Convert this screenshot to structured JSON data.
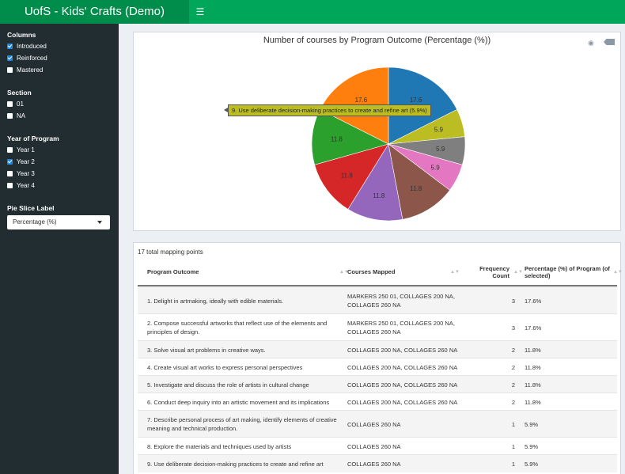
{
  "header": {
    "title": "UofS - Kids' Crafts (Demo)",
    "menu_icon": "hamburger-icon"
  },
  "sidebar": {
    "columns": {
      "title": "Columns",
      "options": [
        {
          "label": "Introduced",
          "checked": true
        },
        {
          "label": "Reinforced",
          "checked": true
        },
        {
          "label": "Mastered",
          "checked": false
        }
      ]
    },
    "section": {
      "title": "Section",
      "options": [
        {
          "label": "01",
          "checked": false
        },
        {
          "label": "NA",
          "checked": false
        }
      ]
    },
    "year": {
      "title": "Year of Program",
      "options": [
        {
          "label": "Year 1",
          "checked": false
        },
        {
          "label": "Year 2",
          "checked": true
        },
        {
          "label": "Year 3",
          "checked": false
        },
        {
          "label": "Year 4",
          "checked": false
        }
      ]
    },
    "pie_label": {
      "title": "Pie Slice Label",
      "selected": "Percentage (%)"
    }
  },
  "chart_data": {
    "type": "pie",
    "title": "Number of courses by Program Outcome (Percentage (%))",
    "slices": [
      {
        "label": "1. Delight in artmaking, ideally with edible materials.",
        "value": 17.6,
        "text": "17.6",
        "color": "#1f77b4"
      },
      {
        "label": "9. Use deliberate decision-making practices to create and refine art",
        "value": 5.9,
        "text": "5.9",
        "color": "#bcbd22"
      },
      {
        "label": "8. Explore the materials and techniques used by artists",
        "value": 5.9,
        "text": "5.9",
        "color": "#7f7f7f"
      },
      {
        "label": "7. Describe personal process of art making, identify elements of creative meaning and technical production.",
        "value": 5.9,
        "text": "5.9",
        "color": "#e377c2"
      },
      {
        "label": "6. Conduct deep inquiry into an artistic movement and its implications",
        "value": 11.8,
        "text": "11.8",
        "color": "#8c564b"
      },
      {
        "label": "5. Investigate and discuss the role of artists in cultural change",
        "value": 11.8,
        "text": "11.8",
        "color": "#9467bd"
      },
      {
        "label": "4. Create visual art works to express personal perspectives",
        "value": 11.8,
        "text": "11.8",
        "color": "#d62728"
      },
      {
        "label": "3. Solve visual art problems in creative ways.",
        "value": 11.8,
        "text": "11.8",
        "color": "#2ca02c"
      },
      {
        "label": "2. Compose successful artworks that reflect use of the elements and principles of design.",
        "value": 17.6,
        "text": "17.6",
        "color": "#ff7f0e"
      }
    ],
    "hover_text": "9. Use deliberate decision-making practices to create and refine art (5.9%)",
    "modebar_icons": [
      "camera-icon",
      "plotly-logo-icon"
    ]
  },
  "table": {
    "summary": "17 total mapping points",
    "columns": [
      "Program Outcome",
      "Courses Mapped",
      "Frequency Count",
      "Percentage (%) of Program (of selected)"
    ],
    "rows": [
      {
        "outcome": "1. Delight in artmaking, ideally with edible materials.",
        "courses": "MARKERS 250 01, COLLAGES 200 NA, COLLAGES 260 NA",
        "count": "3",
        "pct": "17.6%"
      },
      {
        "outcome": "2. Compose successful artworks that reflect use of the elements and principles of design.",
        "courses": "MARKERS 250 01, COLLAGES 200 NA, COLLAGES 260 NA",
        "count": "3",
        "pct": "17.6%"
      },
      {
        "outcome": "3. Solve visual art problems in creative ways.",
        "courses": "COLLAGES 200 NA, COLLAGES 260 NA",
        "count": "2",
        "pct": "11.8%"
      },
      {
        "outcome": "4. Create visual art works to express personal perspectives",
        "courses": "COLLAGES 200 NA, COLLAGES 260 NA",
        "count": "2",
        "pct": "11.8%"
      },
      {
        "outcome": "5. Investigate and discuss the role of artists in cultural change",
        "courses": "COLLAGES 200 NA, COLLAGES 260 NA",
        "count": "2",
        "pct": "11.8%"
      },
      {
        "outcome": "6. Conduct deep inquiry into an artistic movement and its implications",
        "courses": "COLLAGES 200 NA, COLLAGES 260 NA",
        "count": "2",
        "pct": "11.8%"
      },
      {
        "outcome": "7. Describe personal process of art making, identify elements of creative meaning and technical production.",
        "courses": "COLLAGES 260 NA",
        "count": "1",
        "pct": "5.9%"
      },
      {
        "outcome": "8. Explore the materials and techniques used by artists",
        "courses": "COLLAGES 260 NA",
        "count": "1",
        "pct": "5.9%"
      },
      {
        "outcome": "9. Use deliberate decision-making practices to create and refine art",
        "courses": "COLLAGES 260 NA",
        "count": "1",
        "pct": "5.9%"
      }
    ]
  }
}
